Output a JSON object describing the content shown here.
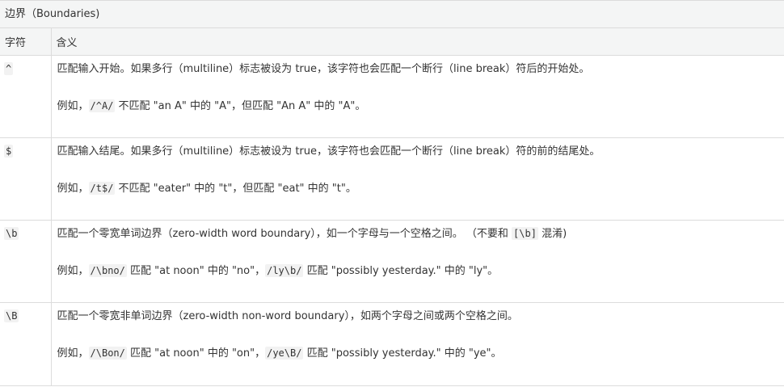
{
  "caption": "边界（Boundaries)",
  "header": {
    "col_char": "字符",
    "col_meaning": "含义"
  },
  "rows": [
    {
      "char": "^",
      "desc": "匹配输入开始。如果多行（multiline）标志被设为 true，该字符也会匹配一个断行（line break）符后的开始处。",
      "example": {
        "prefix": "例如，",
        "code1": "/^A/",
        "mid1": " 不匹配 \"an A\" 中的 \"A\"，但匹配 \"An A\" 中的 \"A\"。"
      }
    },
    {
      "char": "$",
      "desc": "匹配输入结尾。如果多行（multiline）标志被设为 true，该字符也会匹配一个断行（line break）符的前的结尾处。",
      "example": {
        "prefix": "例如，",
        "code1": "/t$/",
        "mid1": " 不匹配 \"eater\" 中的 \"t\"，但匹配 \"eat\" 中的 \"t\"。"
      }
    },
    {
      "char": "\\b",
      "desc_pre": "匹配一个零宽单词边界（zero-width word boundary），如一个字母与一个空格之间。 （不要和 ",
      "desc_code": "[\\b]",
      "desc_post": " 混淆)",
      "example": {
        "prefix": "例如，",
        "code1": "/\\bno/",
        "mid1": " 匹配 \"at noon\" 中的 \"no\"，",
        "code2": "/ly\\b/",
        "mid2": " 匹配 \"possibly yesterday.\" 中的 \"ly\"。"
      }
    },
    {
      "char": "\\B",
      "desc": "匹配一个零宽非单词边界（zero-width non-word boundary），如两个字母之间或两个空格之间。",
      "example": {
        "prefix": "例如，",
        "code1": "/\\Bon/",
        "mid1": " 匹配 \"at noon\" 中的 \"on\"，",
        "code2": "/ye\\B/",
        "mid2": " 匹配 \"possibly yesterday.\" 中的 \"ye\"。"
      }
    }
  ]
}
